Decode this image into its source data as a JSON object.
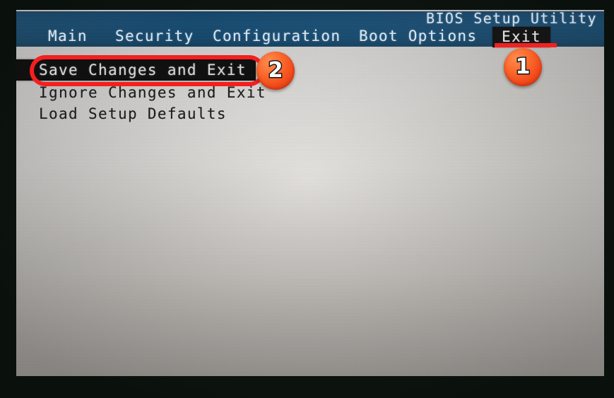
{
  "screen": {
    "title": "BIOS Setup Utility",
    "menu_tabs": [
      {
        "label": "Main",
        "selected": false
      },
      {
        "label": "Security",
        "selected": false
      },
      {
        "label": "Configuration",
        "selected": false
      },
      {
        "label": "Boot Options",
        "selected": false
      },
      {
        "label": "Exit",
        "selected": true
      }
    ],
    "menu_items": [
      {
        "label": "Save Changes and Exit",
        "highlighted": true
      },
      {
        "label": "Ignore Changes and Exit",
        "highlighted": false
      },
      {
        "label": "Load Setup Defaults",
        "highlighted": false
      }
    ]
  },
  "annotations": {
    "accent_color": "#f51f1f",
    "badge_color": "#f0481a",
    "badges": [
      {
        "number": "1",
        "target": "exit-tab"
      },
      {
        "number": "2",
        "target": "save-changes-and-exit-row"
      }
    ],
    "underline_target": "Exit",
    "rect_target": "Save Changes and Exit"
  },
  "colors": {
    "header_blue": "#17517f",
    "screen_background": "#e9e8e5",
    "highlight_background": "#101011",
    "highlight_text": "#d8d8d6",
    "frame": "#0d1510"
  }
}
